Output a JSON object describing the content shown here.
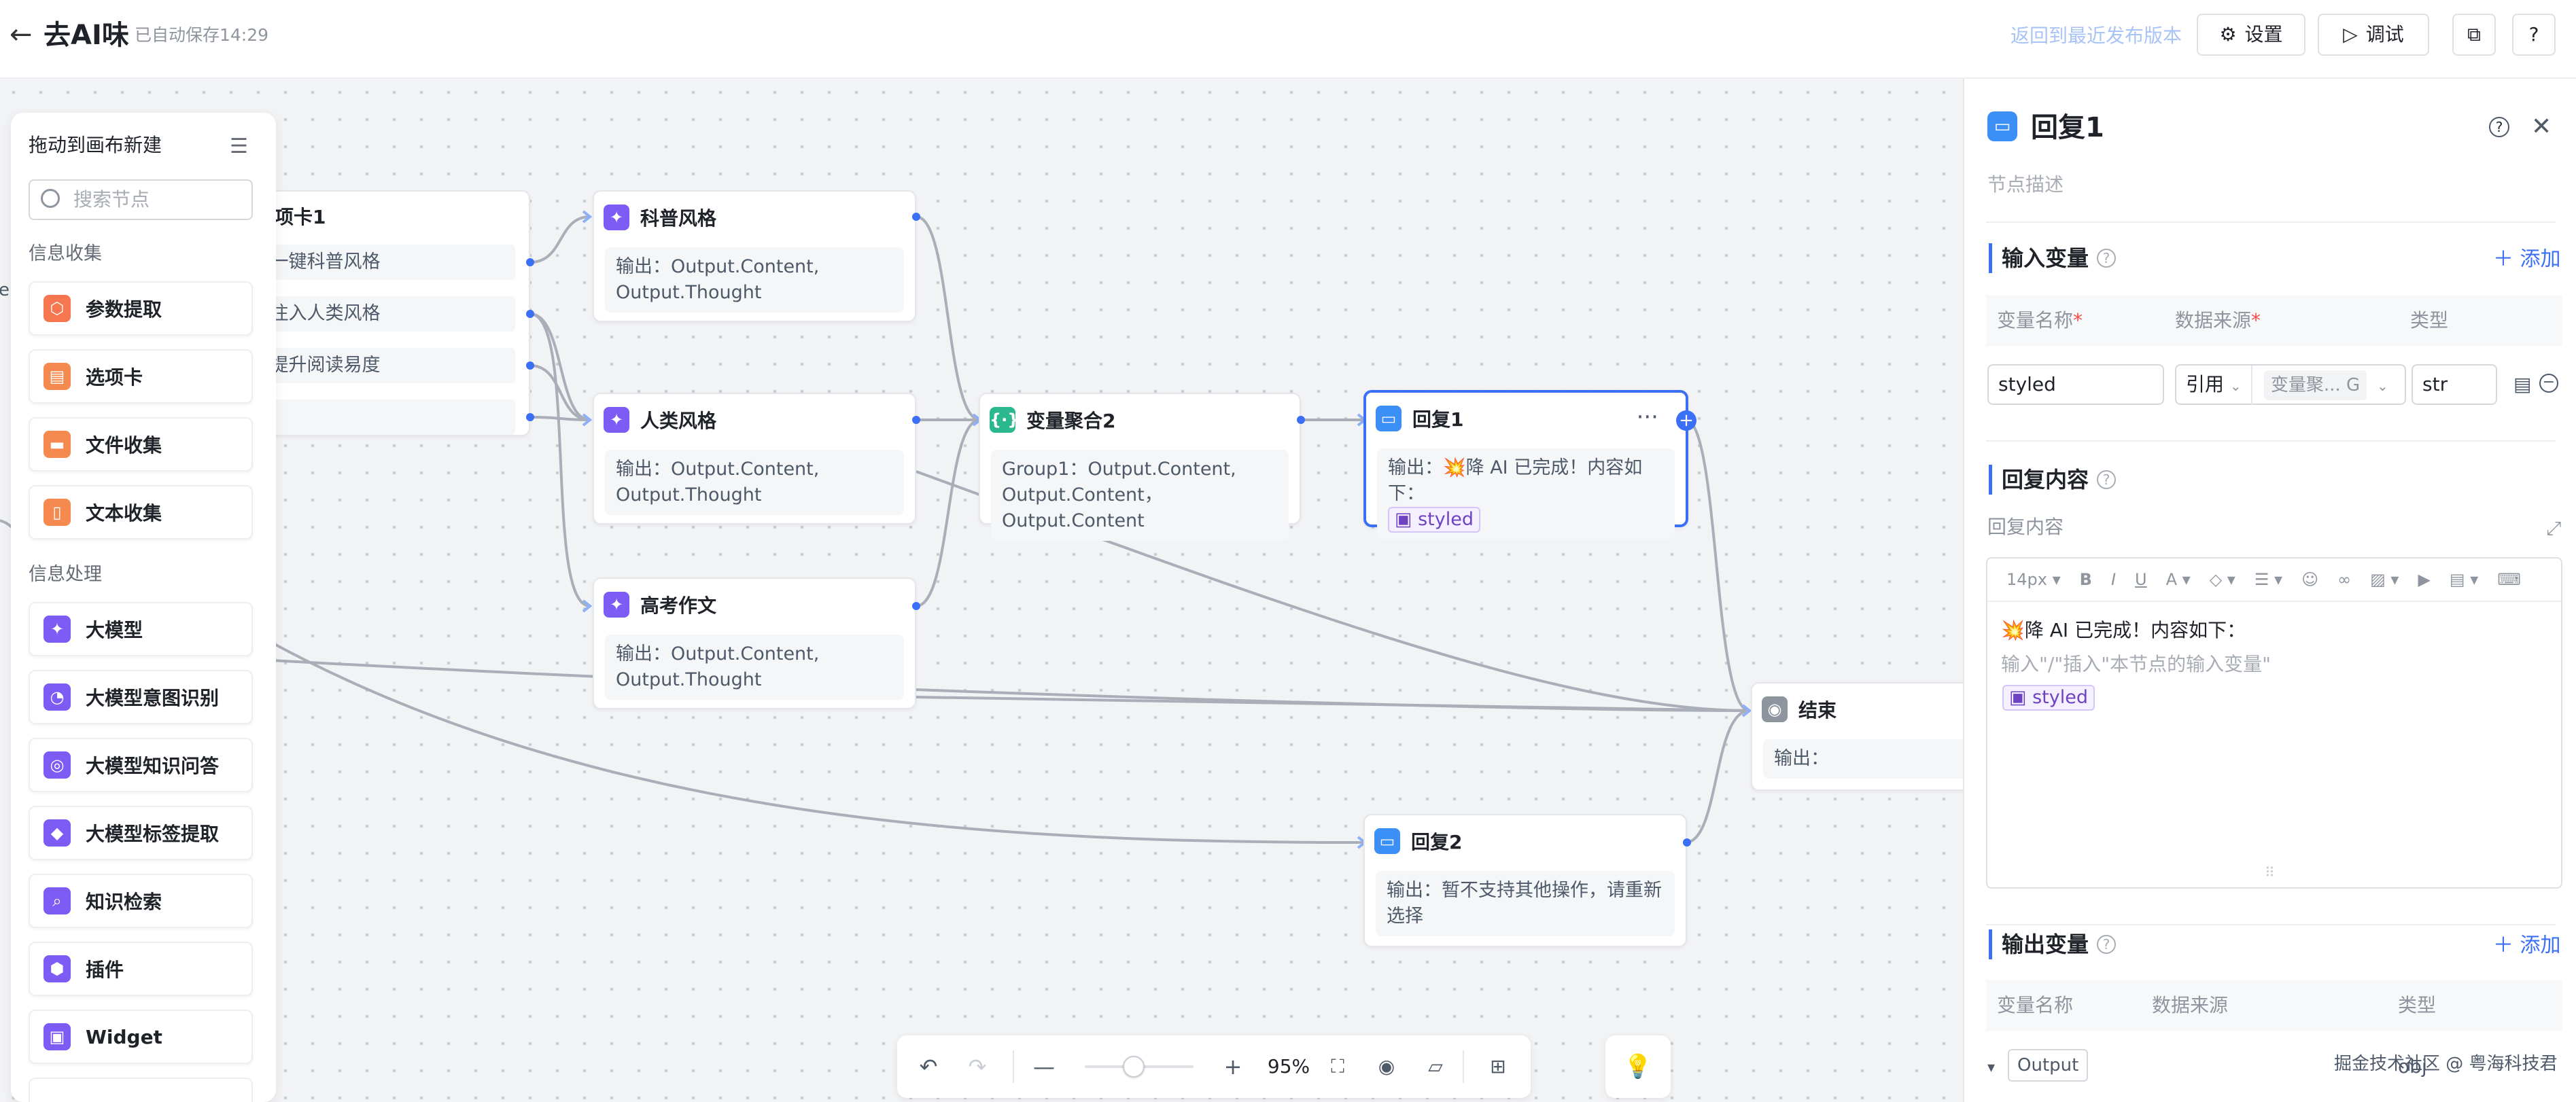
{
  "topbar": {
    "title": "去AI味",
    "saved": "已自动保存14:29",
    "revert": "返回到最近发布版本",
    "settings": "设置",
    "debug": "调试"
  },
  "left_panel": {
    "header": "拖动到画布新建",
    "search_placeholder": "搜索节点",
    "group_collect": "信息收集",
    "group_process": "信息处理",
    "items": [
      {
        "label": "参数提取",
        "color": "#f5764f",
        "icon": "param-icon"
      },
      {
        "label": "选项卡",
        "color": "#f5894f",
        "icon": "option-card-icon"
      },
      {
        "label": "文件收集",
        "color": "#f5894f",
        "icon": "folder-icon"
      },
      {
        "label": "文本收集",
        "color": "#f5894f",
        "icon": "document-icon"
      },
      {
        "label": "大模型",
        "color": "#7c5cf5",
        "icon": "sparkle-icon"
      },
      {
        "label": "大模型意图识别",
        "color": "#7c5cf5",
        "icon": "robot-icon"
      },
      {
        "label": "大模型知识问答",
        "color": "#7c5cf5",
        "icon": "qa-icon"
      },
      {
        "label": "大模型标签提取",
        "color": "#7c5cf5",
        "icon": "tag-icon"
      },
      {
        "label": "知识检索",
        "color": "#7c5cf5",
        "icon": "search-icon"
      },
      {
        "label": "插件",
        "color": "#7c5cf5",
        "icon": "plugin-icon"
      },
      {
        "label": "Widget",
        "color": "#7c5cf5",
        "icon": "widget-icon"
      }
    ]
  },
  "canvas": {
    "option_card": {
      "title": "项卡1",
      "options": [
        "一键科普风格",
        "注入人类风格",
        "提升阅读易度"
      ]
    },
    "nodes": {
      "science": {
        "title": "科普风格",
        "output": "输出：Output.Content,\nOutput.Thought"
      },
      "human": {
        "title": "人类风格",
        "output": "输出：Output.Content,\nOutput.Thought"
      },
      "exam": {
        "title": "高考作文",
        "output": "输出：Output.Content,\nOutput.Thought"
      },
      "aggregate": {
        "title": "变量聚合2",
        "output": "Group1：Output.Content,\nOutput.Content，Output.Content"
      },
      "reply1": {
        "title": "回复1",
        "output_prefix": "输出：",
        "output_text": "💥降 AI 已完成！内容如下：",
        "tag": "styled"
      },
      "reply2": {
        "title": "回复2",
        "output": "输出：暂不支持其他操作，请重新\n选择"
      },
      "end": {
        "title": "结束",
        "output": "输出："
      }
    },
    "cut_text": "er"
  },
  "bottom_bar": {
    "zoom": "95%",
    "zoom_level": 0.45
  },
  "right_panel": {
    "title": "回复1",
    "description_placeholder": "节点描述",
    "input_vars": {
      "label": "输入变量",
      "add": "添加",
      "col_name": "变量名称",
      "col_source": "数据来源",
      "col_type": "类型",
      "row": {
        "name": "styled",
        "source_type": "引用",
        "source_value": "变量聚... G",
        "type": "str"
      }
    },
    "reply_content": {
      "label": "回复内容",
      "sub": "回复内容",
      "font_size": "14px",
      "line1": "💥降 AI 已完成！内容如下：",
      "placeholder": "输入\"/\"插入\"本节点的输入变量\"",
      "tag": "styled"
    },
    "output_vars": {
      "label": "输出变量",
      "add": "添加",
      "col_name": "变量名称",
      "col_source": "数据来源",
      "col_type": "类型",
      "row_name": "Output",
      "row_type": "obj"
    }
  },
  "watermark": "掘金技术社区 @ 粤海科技君"
}
